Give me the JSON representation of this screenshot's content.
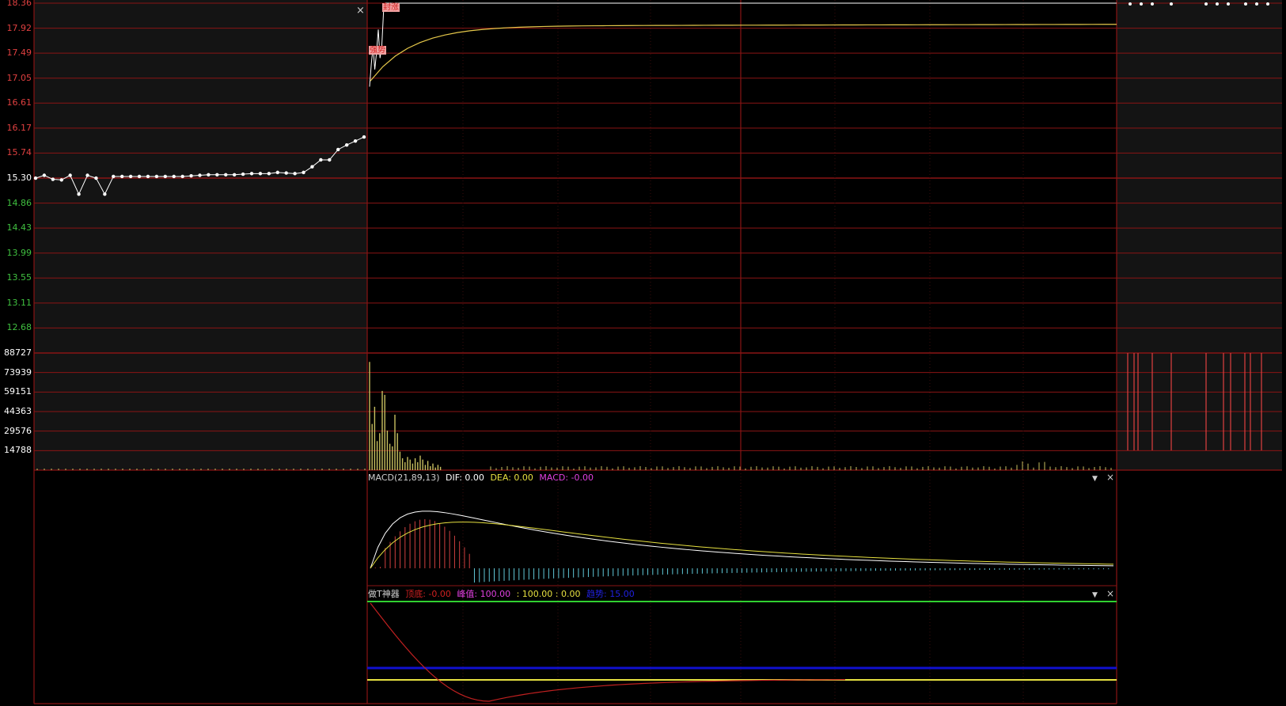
{
  "colors": {
    "background": "#000000",
    "panel_bg": "#141414",
    "grid_red": "#8a1414",
    "grid_dark": "#3a0d0d",
    "price_up": "#e04040",
    "price_down": "#40c040",
    "price_line": "#ffffff",
    "avg_line": "#e6c84a",
    "volume_bar": "#c8c060",
    "dif_color": "#ffffff",
    "dea_color": "#e6e040",
    "macd_pos": "#d04040",
    "macd_neg": "#60c8d8",
    "label_magenta": "#e040e0",
    "green_line": "#30d030",
    "blue_line": "#1010d0",
    "yellow_line": "#e6e040",
    "red_curve": "#c02020",
    "tag_bg": "#f0a0a0",
    "tag_text": "#d02020",
    "label_gray": "#cfcfcf"
  },
  "price_axis": {
    "labels": [
      "18.36",
      "17.92",
      "17.49",
      "17.05",
      "16.61",
      "16.17",
      "15.74",
      "15.30",
      "14.86",
      "14.43",
      "13.99",
      "13.55",
      "13.11",
      "12.68"
    ],
    "prev_close": "15.30"
  },
  "volume_axis": {
    "labels": [
      "88727",
      "73939",
      "59151",
      "44363",
      "29576",
      "14788"
    ]
  },
  "price_chart": {
    "close_icon": "×",
    "tags": [
      "封涨",
      "强势"
    ]
  },
  "macd_panel": {
    "name": "MACD(21,89,13)",
    "dif": "DIF: 0.00",
    "dea": "DEA: 0.00",
    "macd": "MACD: -0.00",
    "dropdown_icon": "▼",
    "close_icon": "×"
  },
  "t_panel": {
    "name": "做T神器",
    "bottom": "顶底: -0.00",
    "peak": "峰值: 100.00",
    "values": ": 100.00 : 0.00",
    "line": "趋势: 15.00",
    "dropdown_icon": "▼",
    "close_icon": "×"
  },
  "chart_data": {
    "type": "line",
    "prev_close": 15.3,
    "ylim": [
      12.68,
      18.36
    ],
    "price_prev_day": [
      15.3,
      15.35,
      15.28,
      15.27,
      15.35,
      15.02,
      15.35,
      15.3,
      15.02,
      15.33,
      15.33,
      15.33,
      15.33,
      15.33,
      15.33,
      15.33,
      15.33,
      15.33,
      15.34,
      15.35,
      15.36,
      15.36,
      15.36,
      15.36,
      15.37,
      15.38,
      15.38,
      15.38,
      15.4,
      15.39,
      15.38,
      15.4,
      15.5,
      15.62,
      15.62,
      15.8,
      15.88,
      15.95,
      16.02
    ],
    "price_today_early": [
      16.9,
      17.3,
      17.6,
      17.2,
      17.5,
      17.9,
      17.4,
      17.6,
      18.2,
      18.36
    ],
    "avg_today_final": 17.96,
    "volume_ylim": [
      0,
      88727
    ],
    "volume_early": [
      82000,
      35000,
      48000,
      22000,
      28000,
      60000,
      57000,
      30000,
      20000,
      18000,
      42000,
      28000,
      14000,
      9000,
      6000,
      10000,
      8000,
      5000,
      9000,
      6000,
      11000,
      8000,
      4000,
      7000,
      3000,
      5000,
      2000,
      4000,
      2500
    ],
    "macd": {
      "dif": 0.0,
      "dea": 0.0,
      "macd": -0.0
    },
    "t_indicator": {
      "bottom": -0.0,
      "peak": 100.0,
      "v1": 100.0,
      "v2": 0.0,
      "line": 15.0
    }
  }
}
